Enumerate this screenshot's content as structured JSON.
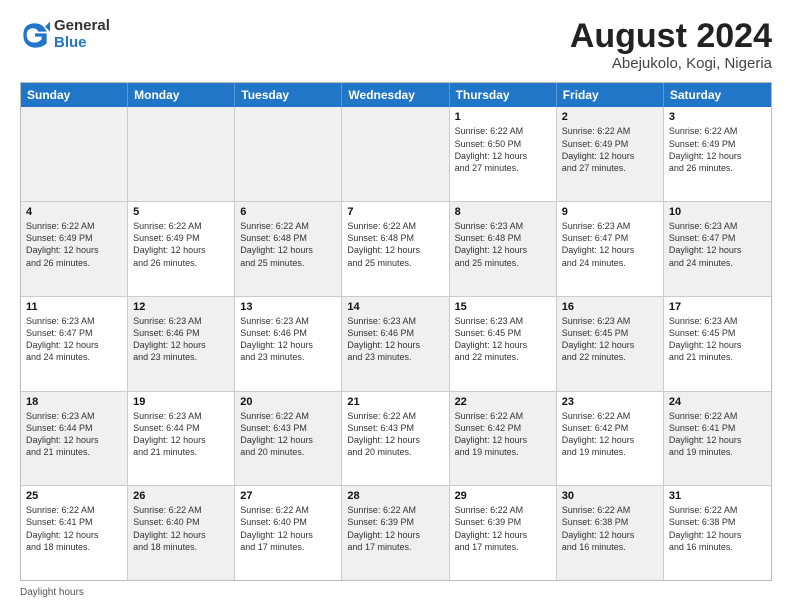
{
  "logo": {
    "general": "General",
    "blue": "Blue"
  },
  "title": {
    "month_year": "August 2024",
    "location": "Abejukolo, Kogi, Nigeria"
  },
  "footer": {
    "label": "Daylight hours"
  },
  "header_days": [
    "Sunday",
    "Monday",
    "Tuesday",
    "Wednesday",
    "Thursday",
    "Friday",
    "Saturday"
  ],
  "rows": [
    [
      {
        "day": "",
        "info": "",
        "shaded": true
      },
      {
        "day": "",
        "info": "",
        "shaded": true
      },
      {
        "day": "",
        "info": "",
        "shaded": true
      },
      {
        "day": "",
        "info": "",
        "shaded": true
      },
      {
        "day": "1",
        "info": "Sunrise: 6:22 AM\nSunset: 6:50 PM\nDaylight: 12 hours\nand 27 minutes."
      },
      {
        "day": "2",
        "info": "Sunrise: 6:22 AM\nSunset: 6:49 PM\nDaylight: 12 hours\nand 27 minutes.",
        "shaded": true
      },
      {
        "day": "3",
        "info": "Sunrise: 6:22 AM\nSunset: 6:49 PM\nDaylight: 12 hours\nand 26 minutes."
      }
    ],
    [
      {
        "day": "4",
        "info": "Sunrise: 6:22 AM\nSunset: 6:49 PM\nDaylight: 12 hours\nand 26 minutes.",
        "shaded": true
      },
      {
        "day": "5",
        "info": "Sunrise: 6:22 AM\nSunset: 6:49 PM\nDaylight: 12 hours\nand 26 minutes."
      },
      {
        "day": "6",
        "info": "Sunrise: 6:22 AM\nSunset: 6:48 PM\nDaylight: 12 hours\nand 25 minutes.",
        "shaded": true
      },
      {
        "day": "7",
        "info": "Sunrise: 6:22 AM\nSunset: 6:48 PM\nDaylight: 12 hours\nand 25 minutes."
      },
      {
        "day": "8",
        "info": "Sunrise: 6:23 AM\nSunset: 6:48 PM\nDaylight: 12 hours\nand 25 minutes.",
        "shaded": true
      },
      {
        "day": "9",
        "info": "Sunrise: 6:23 AM\nSunset: 6:47 PM\nDaylight: 12 hours\nand 24 minutes."
      },
      {
        "day": "10",
        "info": "Sunrise: 6:23 AM\nSunset: 6:47 PM\nDaylight: 12 hours\nand 24 minutes.",
        "shaded": true
      }
    ],
    [
      {
        "day": "11",
        "info": "Sunrise: 6:23 AM\nSunset: 6:47 PM\nDaylight: 12 hours\nand 24 minutes."
      },
      {
        "day": "12",
        "info": "Sunrise: 6:23 AM\nSunset: 6:46 PM\nDaylight: 12 hours\nand 23 minutes.",
        "shaded": true
      },
      {
        "day": "13",
        "info": "Sunrise: 6:23 AM\nSunset: 6:46 PM\nDaylight: 12 hours\nand 23 minutes."
      },
      {
        "day": "14",
        "info": "Sunrise: 6:23 AM\nSunset: 6:46 PM\nDaylight: 12 hours\nand 23 minutes.",
        "shaded": true
      },
      {
        "day": "15",
        "info": "Sunrise: 6:23 AM\nSunset: 6:45 PM\nDaylight: 12 hours\nand 22 minutes."
      },
      {
        "day": "16",
        "info": "Sunrise: 6:23 AM\nSunset: 6:45 PM\nDaylight: 12 hours\nand 22 minutes.",
        "shaded": true
      },
      {
        "day": "17",
        "info": "Sunrise: 6:23 AM\nSunset: 6:45 PM\nDaylight: 12 hours\nand 21 minutes."
      }
    ],
    [
      {
        "day": "18",
        "info": "Sunrise: 6:23 AM\nSunset: 6:44 PM\nDaylight: 12 hours\nand 21 minutes.",
        "shaded": true
      },
      {
        "day": "19",
        "info": "Sunrise: 6:23 AM\nSunset: 6:44 PM\nDaylight: 12 hours\nand 21 minutes."
      },
      {
        "day": "20",
        "info": "Sunrise: 6:22 AM\nSunset: 6:43 PM\nDaylight: 12 hours\nand 20 minutes.",
        "shaded": true
      },
      {
        "day": "21",
        "info": "Sunrise: 6:22 AM\nSunset: 6:43 PM\nDaylight: 12 hours\nand 20 minutes."
      },
      {
        "day": "22",
        "info": "Sunrise: 6:22 AM\nSunset: 6:42 PM\nDaylight: 12 hours\nand 19 minutes.",
        "shaded": true
      },
      {
        "day": "23",
        "info": "Sunrise: 6:22 AM\nSunset: 6:42 PM\nDaylight: 12 hours\nand 19 minutes."
      },
      {
        "day": "24",
        "info": "Sunrise: 6:22 AM\nSunset: 6:41 PM\nDaylight: 12 hours\nand 19 minutes.",
        "shaded": true
      }
    ],
    [
      {
        "day": "25",
        "info": "Sunrise: 6:22 AM\nSunset: 6:41 PM\nDaylight: 12 hours\nand 18 minutes."
      },
      {
        "day": "26",
        "info": "Sunrise: 6:22 AM\nSunset: 6:40 PM\nDaylight: 12 hours\nand 18 minutes.",
        "shaded": true
      },
      {
        "day": "27",
        "info": "Sunrise: 6:22 AM\nSunset: 6:40 PM\nDaylight: 12 hours\nand 17 minutes."
      },
      {
        "day": "28",
        "info": "Sunrise: 6:22 AM\nSunset: 6:39 PM\nDaylight: 12 hours\nand 17 minutes.",
        "shaded": true
      },
      {
        "day": "29",
        "info": "Sunrise: 6:22 AM\nSunset: 6:39 PM\nDaylight: 12 hours\nand 17 minutes."
      },
      {
        "day": "30",
        "info": "Sunrise: 6:22 AM\nSunset: 6:38 PM\nDaylight: 12 hours\nand 16 minutes.",
        "shaded": true
      },
      {
        "day": "31",
        "info": "Sunrise: 6:22 AM\nSunset: 6:38 PM\nDaylight: 12 hours\nand 16 minutes."
      }
    ]
  ]
}
